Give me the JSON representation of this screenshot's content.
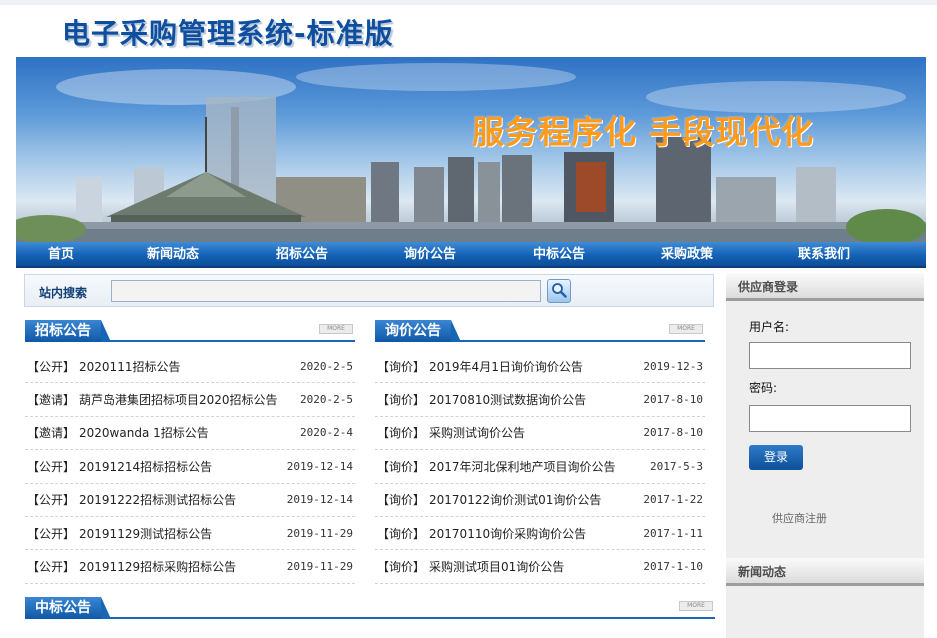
{
  "header": {
    "site_title": "电子采购管理系统-标准版",
    "banner_slogan": "服务程序化  手段现代化"
  },
  "nav": {
    "items": [
      "首页",
      "新闻动态",
      "招标公告",
      "询价公告",
      "中标公告",
      "采购政策",
      "联系我们"
    ]
  },
  "search": {
    "label": "站内搜索",
    "placeholder": "",
    "button_icon": "search-icon"
  },
  "tender": {
    "title": "招标公告",
    "more": "MORE",
    "rows": [
      {
        "tag": "【公开】",
        "title": "2020111招标公告",
        "date": "2020-2-5"
      },
      {
        "tag": "【邀请】",
        "title": "葫芦岛港集团招标项目2020招标公告",
        "date": "2020-2-5"
      },
      {
        "tag": "【邀请】",
        "title": "2020wanda 1招标公告",
        "date": "2020-2-4"
      },
      {
        "tag": "【公开】",
        "title": "20191214招标招标公告",
        "date": "2019-12-14"
      },
      {
        "tag": "【公开】",
        "title": "20191222招标测试招标公告",
        "date": "2019-12-14"
      },
      {
        "tag": "【公开】",
        "title": "20191129测试招标公告",
        "date": "2019-11-29"
      },
      {
        "tag": "【公开】",
        "title": "20191129招标采购招标公告",
        "date": "2019-11-29"
      }
    ]
  },
  "inquiry": {
    "title": "询价公告",
    "more": "MORE",
    "rows": [
      {
        "tag": "【询价】",
        "title": "2019年4月1日询价询价公告",
        "date": "2019-12-3"
      },
      {
        "tag": "【询价】",
        "title": "20170810测试数据询价公告",
        "date": "2017-8-10"
      },
      {
        "tag": "【询价】",
        "title": "采购测试询价公告",
        "date": "2017-8-10"
      },
      {
        "tag": "【询价】",
        "title": "2017年河北保利地产项目询价公告",
        "date": "2017-5-3"
      },
      {
        "tag": "【询价】",
        "title": "20170122询价测试01询价公告",
        "date": "2017-1-22"
      },
      {
        "tag": "【询价】",
        "title": "20170110询价采购询价公告",
        "date": "2017-1-11"
      },
      {
        "tag": "【询价】",
        "title": "采购测试项目01询价公告",
        "date": "2017-1-10"
      }
    ]
  },
  "award": {
    "title": "中标公告",
    "more": "MORE"
  },
  "sidebar": {
    "login_title": "供应商登录",
    "username_label": "用户名:",
    "password_label": "密码:",
    "login_button": "登录",
    "register_link": "供应商注册",
    "news_title": "新闻动态"
  },
  "colors": {
    "primary_blue": "#1462b6",
    "slogan_orange": "#ff9a1a",
    "title_blue": "#0d4e9e"
  }
}
